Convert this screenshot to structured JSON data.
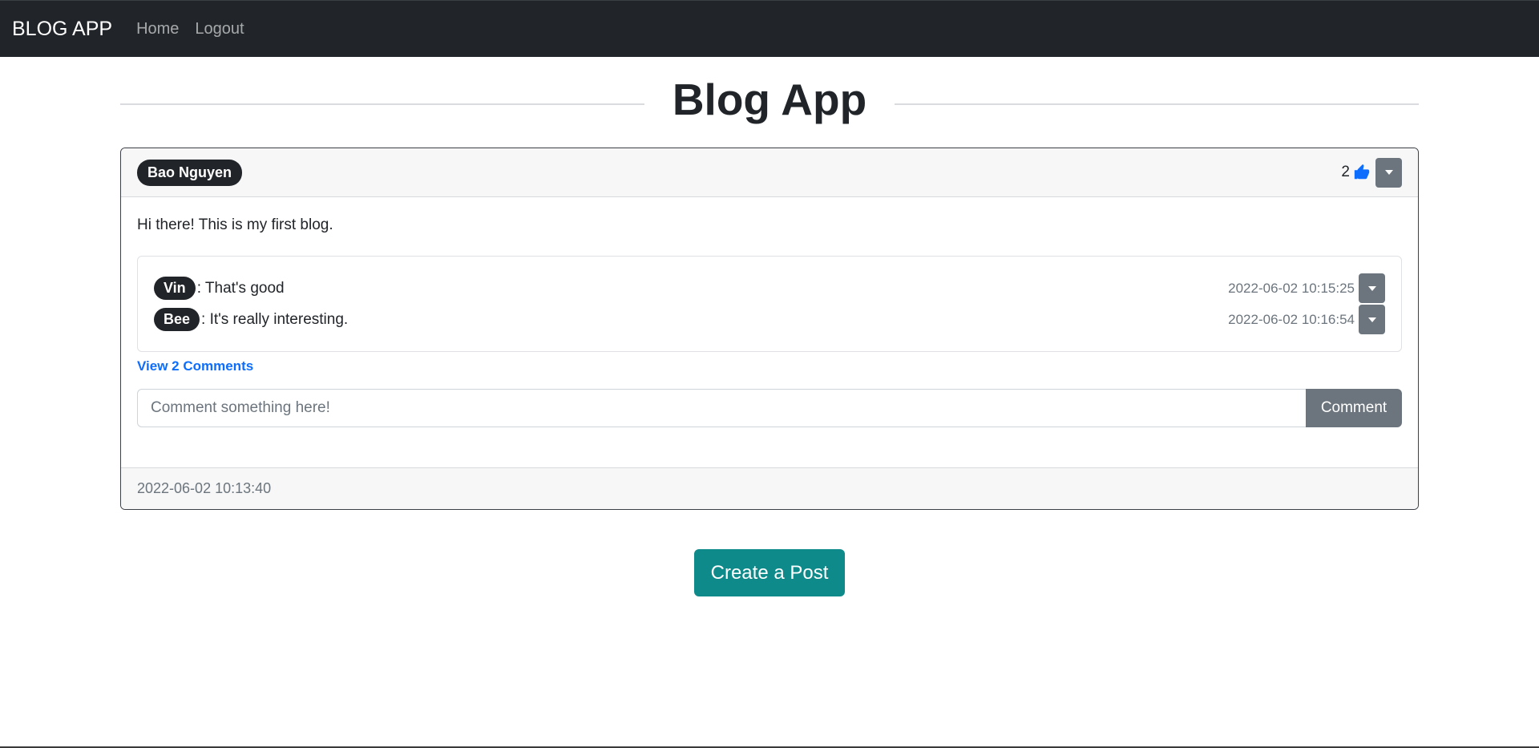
{
  "nav": {
    "brand": "BLOG APP",
    "links": [
      "Home",
      "Logout"
    ]
  },
  "page": {
    "title": "Blog App"
  },
  "post": {
    "author": "Bao Nguyen",
    "likes": "2",
    "content": "Hi there! This is my first blog.",
    "comments": [
      {
        "author": "Vin",
        "text": ": That's good",
        "time": "2022-06-02 10:15:25"
      },
      {
        "author": "Bee",
        "text": ": It's really interesting.",
        "time": "2022-06-02 10:16:54"
      }
    ],
    "view_comments_label": "View 2 Comments",
    "comment_placeholder": "Comment something here!",
    "comment_button": "Comment",
    "timestamp": "2022-06-02 10:13:40"
  },
  "actions": {
    "create_post": "Create a Post"
  },
  "colors": {
    "navbar": "#212529",
    "link": "#0d6efd",
    "secondary": "#6c757d",
    "create_button": "#0f8a8a"
  },
  "icons": {
    "like": "thumbs-up-icon",
    "dropdown": "caret-down-icon"
  }
}
